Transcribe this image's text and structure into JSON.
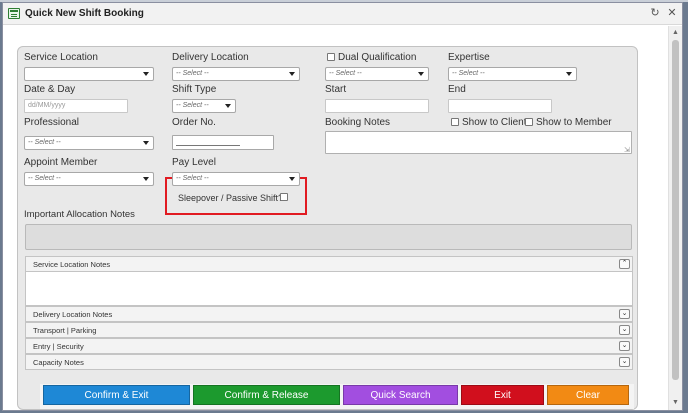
{
  "window": {
    "title": "Quick New Shift Booking"
  },
  "form": {
    "service_location": {
      "label": "Service Location",
      "value": ""
    },
    "delivery_location": {
      "label": "Delivery Location",
      "value": "-- Select --"
    },
    "dual_qualification": {
      "label": "Dual Qualification",
      "checked": false
    },
    "expertise": {
      "label": "Expertise",
      "value": "-- Select --"
    },
    "date_day": {
      "label": "Date & Day",
      "placeholder": "dd/MM/yyyy"
    },
    "shift_type": {
      "label": "Shift Type",
      "value": "-- Select --"
    },
    "start": {
      "label": "Start",
      "value": ""
    },
    "end": {
      "label": "End",
      "value": ""
    },
    "professional": {
      "label": "Professional",
      "value": "-- Select --"
    },
    "order_no": {
      "label": "Order No.",
      "value": ""
    },
    "booking_notes": {
      "label": "Booking Notes",
      "value": ""
    },
    "show_to_client": {
      "label": "Show to Client",
      "checked": false
    },
    "show_to_member": {
      "label": "Show to Member",
      "checked": false
    },
    "appoint_member": {
      "label": "Appoint Member",
      "value": "-- Select --"
    },
    "pay_level": {
      "label": "Pay Level",
      "value": "-- Select --"
    },
    "sleepover": {
      "label": "Sleepover / Passive Shift?",
      "checked": false
    },
    "important_notes": {
      "label": "Important Allocation Notes",
      "value": ""
    }
  },
  "accordion": [
    {
      "label": "Service Location Notes",
      "expanded": true,
      "icon": "chevron-up-icon"
    },
    {
      "label": "Delivery Location Notes",
      "expanded": false,
      "icon": "chevron-down-icon"
    },
    {
      "label": "Transport | Parking",
      "expanded": false,
      "icon": "chevron-down-icon"
    },
    {
      "label": "Entry | Security",
      "expanded": false,
      "icon": "chevron-down-icon"
    },
    {
      "label": "Capacity Notes",
      "expanded": false,
      "icon": "chevron-down-icon"
    }
  ],
  "buttons": {
    "confirm_exit": {
      "label": "Confirm & Exit",
      "color": "#1e88d6"
    },
    "confirm_release": {
      "label": "Confirm & Release",
      "color": "#1c9a2e"
    },
    "quick_search": {
      "label": "Quick Search",
      "color": "#a24ee0"
    },
    "exit": {
      "label": "Exit",
      "color": "#d10f1d"
    },
    "clear": {
      "label": "Clear",
      "color": "#f28a14"
    }
  },
  "colors": {
    "highlight": "#e11b22",
    "panel": "#e9e9e9"
  }
}
